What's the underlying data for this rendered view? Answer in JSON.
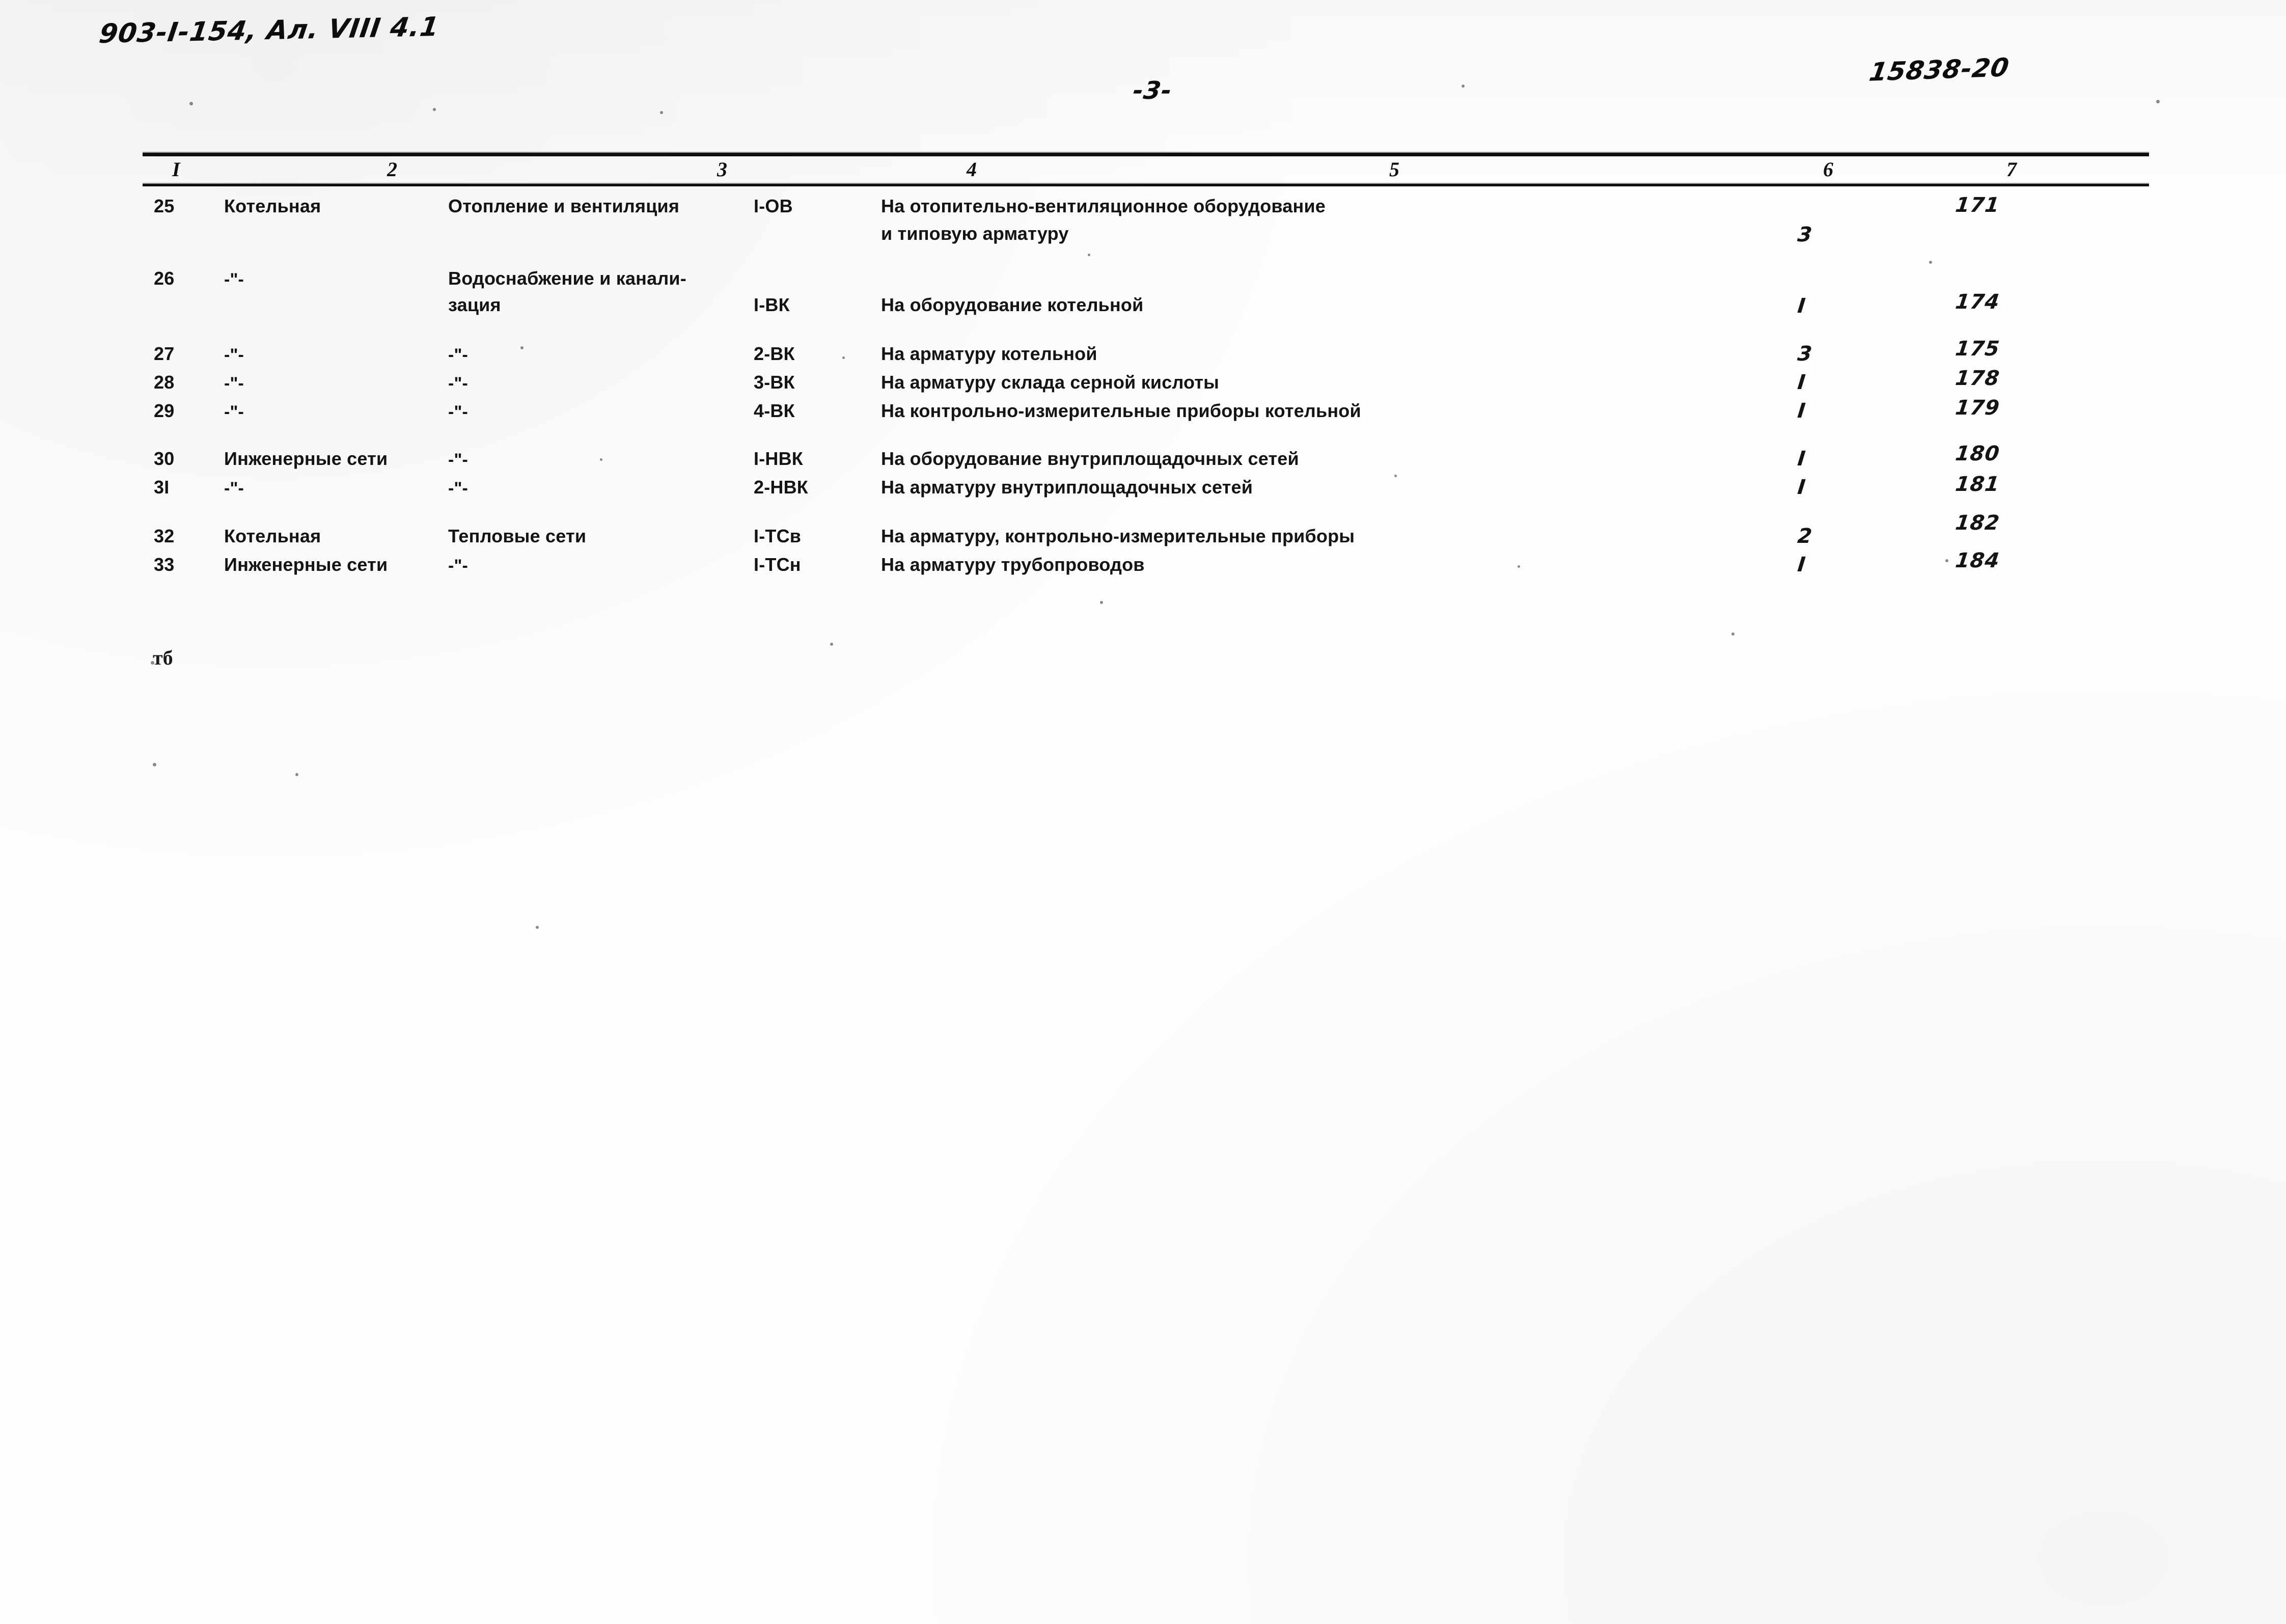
{
  "document": {
    "code_annotation": "903-I-154, Ал. VIII 4.1",
    "archive_number": "15838-20",
    "page_number": "-3-",
    "stray_mark": "тб"
  },
  "table": {
    "column_headers": [
      "I",
      "2",
      "3",
      "4",
      "5",
      "6",
      "7"
    ],
    "rows": [
      {
        "num": "25",
        "object": "Котельная",
        "section": "Отопление и вентиляция",
        "code": "I-ОВ",
        "title_line1": "На отопительно-вентиляционное оборудование",
        "title_line2": "и типовую арматуру",
        "qty": "3",
        "page": "171"
      },
      {
        "num": "26",
        "object": "-\"-",
        "section": "Водоснабжение и канали-",
        "section_line2": "зация",
        "code": "I-ВК",
        "title_line1": "На оборудование котельной",
        "title_line2": "",
        "qty": "I",
        "page": "174"
      },
      {
        "num": "27",
        "object": "-\"-",
        "section": "-\"-",
        "code": "2-ВК",
        "title_line1": "На арматуру котельной",
        "title_line2": "",
        "qty": "3",
        "page": "175"
      },
      {
        "num": "28",
        "object": "-\"-",
        "section": "-\"-",
        "code": "3-ВК",
        "title_line1": "На арматуру склада серной кислоты",
        "title_line2": "",
        "qty": "I",
        "page": "178"
      },
      {
        "num": "29",
        "object": "-\"-",
        "section": "-\"-",
        "code": "4-ВК",
        "title_line1": "На контрольно-измерительные приборы котельной",
        "title_line2": "",
        "qty": "I",
        "page": "179"
      },
      {
        "num": "30",
        "object": "Инженерные сети",
        "section": "-\"-",
        "code": "I-НВК",
        "title_line1": "На оборудование внутриплощадочных сетей",
        "title_line2": "",
        "qty": "I",
        "page": "180"
      },
      {
        "num": "3I",
        "object": "-\"-",
        "section": "-\"-",
        "code": "2-НВК",
        "title_line1": "На арматуру внутриплощадочных сетей",
        "title_line2": "",
        "qty": "I",
        "page": "181"
      },
      {
        "num": "32",
        "object": "Котельная",
        "section": "Тепловые сети",
        "code": "I-ТСв",
        "title_line1": "На арматуру, контрольно-измерительные приборы",
        "title_line2": "",
        "qty": "2",
        "page": "182"
      },
      {
        "num": "33",
        "object": "Инженерные сети",
        "section": "-\"-",
        "code": "I-ТСн",
        "title_line1": "На арматуру трубопроводов",
        "title_line2": "",
        "qty": "I",
        "page": "184"
      }
    ]
  }
}
